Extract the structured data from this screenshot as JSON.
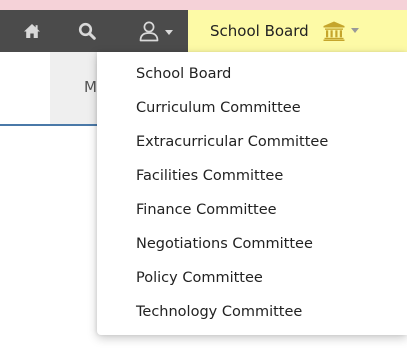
{
  "toolbar": {
    "icons": {
      "home": "home-icon",
      "search": "search-icon",
      "user": "user-icon",
      "caret": "caret-down-icon",
      "board": "bank-icon"
    },
    "board_selector": {
      "label": "School Board"
    }
  },
  "subnav": {
    "active_tab_visible_text": "M"
  },
  "dropdown": {
    "items": [
      {
        "label": "School Board"
      },
      {
        "label": "Curriculum Committee"
      },
      {
        "label": "Extracurricular Committee"
      },
      {
        "label": "Facilities Committee"
      },
      {
        "label": "Finance Committee"
      },
      {
        "label": "Negotiations Committee"
      },
      {
        "label": "Policy Committee"
      },
      {
        "label": "Technology Committee"
      }
    ]
  },
  "colors": {
    "toolbar_bg": "#4b4b4b",
    "toolbar_icon": "#d9d9d9",
    "selector_bg": "#fdfaa6",
    "top_strip": "#f5d2d8",
    "bank_icon": "#c5a52c",
    "tab_underline": "#4a79a8"
  }
}
